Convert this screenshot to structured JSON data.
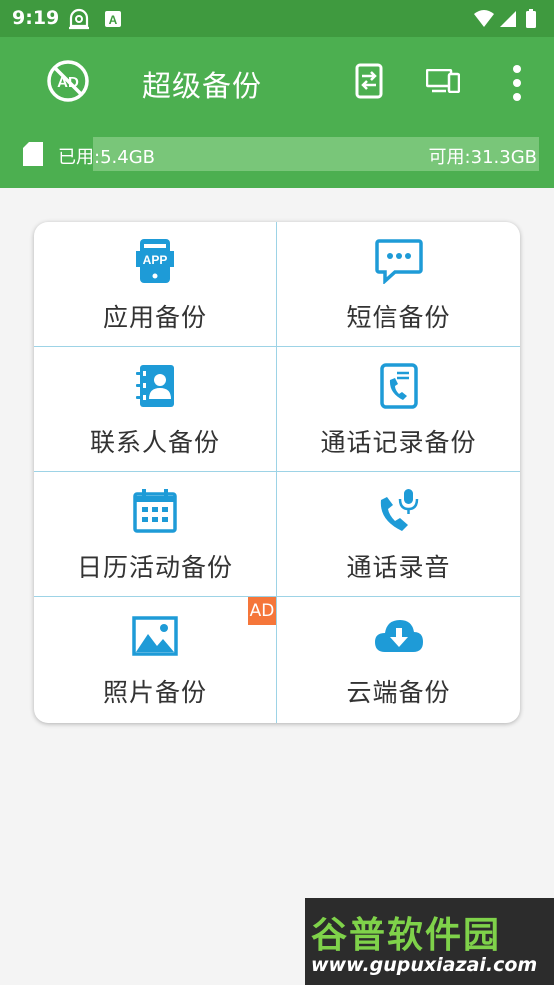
{
  "status_bar": {
    "time": "9:19"
  },
  "app_bar": {
    "title": "超级备份"
  },
  "storage": {
    "used": "已用:5.4GB",
    "free": "可用:31.3GB",
    "used_fraction": 0.148
  },
  "grid": {
    "items": [
      {
        "label": "应用备份",
        "icon": "app-icon"
      },
      {
        "label": "短信备份",
        "icon": "message-icon"
      },
      {
        "label": "联系人备份",
        "icon": "contacts-icon"
      },
      {
        "label": "通话记录备份",
        "icon": "call-log-icon"
      },
      {
        "label": "日历活动备份",
        "icon": "calendar-icon"
      },
      {
        "label": "通话录音",
        "icon": "call-recording-icon"
      },
      {
        "label": "照片备份",
        "icon": "photo-icon",
        "badge": "AD"
      },
      {
        "label": "云端备份",
        "icon": "cloud-download-icon"
      }
    ]
  },
  "watermark": {
    "title": "谷普软件园",
    "url": "www.gupuxiazai.com"
  },
  "colors": {
    "primary": "#4caf50",
    "status_bar": "#3f9a3f",
    "icon_blue": "#1e9bd7",
    "ad_badge": "#f5763a"
  }
}
